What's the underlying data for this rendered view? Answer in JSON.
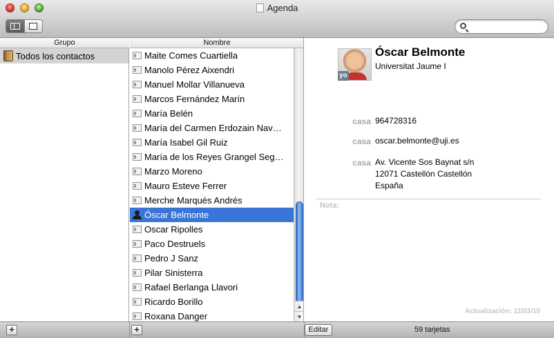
{
  "window": {
    "title": "Agenda"
  },
  "toolbar": {
    "view_modes": [
      "columns-view",
      "card-view"
    ],
    "search_placeholder": ""
  },
  "columns": {
    "group_header": "Grupo",
    "name_header": "Nombre"
  },
  "groups": [
    {
      "label": "Todos los contactos",
      "selected": true
    }
  ],
  "contacts": [
    {
      "name": "Maite Comes Cuartiella",
      "selected": false
    },
    {
      "name": "Manolo Pérez Aixendri",
      "selected": false
    },
    {
      "name": "Manuel Mollar Villanueva",
      "selected": false
    },
    {
      "name": "Marcos Fernández Marín",
      "selected": false
    },
    {
      "name": "María Belén",
      "selected": false
    },
    {
      "name": "María del Carmen Erdozain Nav…",
      "selected": false
    },
    {
      "name": "María Isabel Gil Ruiz",
      "selected": false
    },
    {
      "name": "María de los Reyes Grangel Seg…",
      "selected": false
    },
    {
      "name": "Marzo Moreno",
      "selected": false
    },
    {
      "name": "Mauro Esteve Ferrer",
      "selected": false
    },
    {
      "name": "Merche Marqués Andrés",
      "selected": false
    },
    {
      "name": "Óscar Belmonte",
      "selected": true
    },
    {
      "name": "Oscar Ripolles",
      "selected": false
    },
    {
      "name": "Paco Destruels",
      "selected": false
    },
    {
      "name": "Pedro J Sanz",
      "selected": false
    },
    {
      "name": "Pilar Sinisterra",
      "selected": false
    },
    {
      "name": "Rafael Berlanga Llavori",
      "selected": false
    },
    {
      "name": "Ricardo Borillo",
      "selected": false
    },
    {
      "name": "Roxana Danger",
      "selected": false
    }
  ],
  "detail": {
    "name": "Óscar Belmonte",
    "company": "Universitat Jaume I",
    "me_badge": "yo",
    "phone": {
      "label": "casa",
      "value": "964728316"
    },
    "email": {
      "label": "casa",
      "value": "oscar.belmonte@uji.es"
    },
    "address": {
      "label": "casa",
      "line1": "Av. Vicente Sos Baynat s/n",
      "line2": "12071 Castellón Castellón",
      "line3": "España"
    },
    "note_label": "Nota:",
    "updated": "Actualización: 11/03/10"
  },
  "bottombar": {
    "add_group": "+",
    "add_contact": "+",
    "edit_label": "Editar",
    "card_count": "59 tarjetas"
  },
  "colors": {
    "selection": "#3875d7",
    "label_gray": "#a9a9a9"
  }
}
